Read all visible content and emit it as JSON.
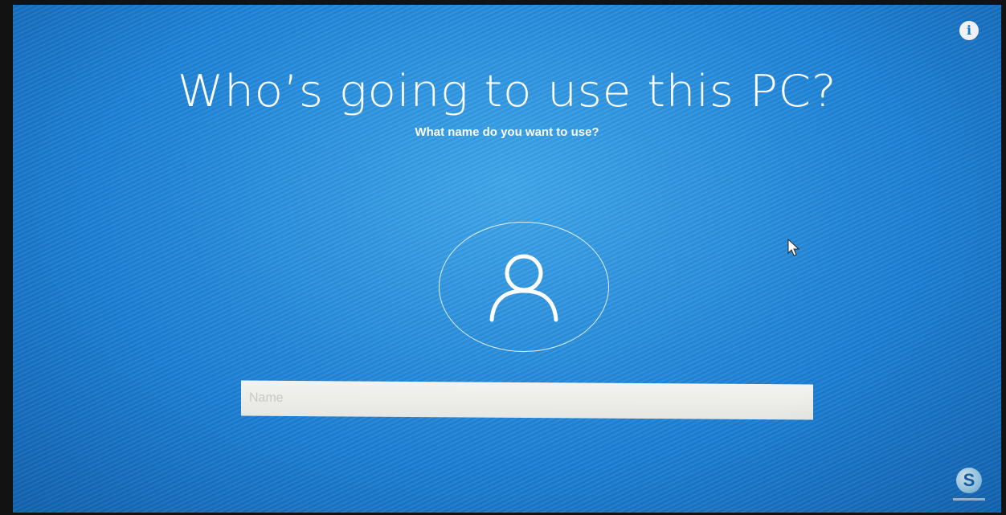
{
  "setup": {
    "title": "Who’s going to use this PC?",
    "subtitle": "What name do you want to use?",
    "name_input": {
      "value": "",
      "placeholder": "Name"
    },
    "info_label": "i"
  },
  "overlay": {
    "brand_glyph": "S"
  },
  "icons": {
    "info": "info-icon",
    "avatar": "user-avatar-icon",
    "cursor": "mouse-cursor-icon",
    "brand": "channel-logo-icon"
  },
  "colors": {
    "background": "#1f86da",
    "text": "#ffffff",
    "input_bg": "#eeeeeb"
  }
}
